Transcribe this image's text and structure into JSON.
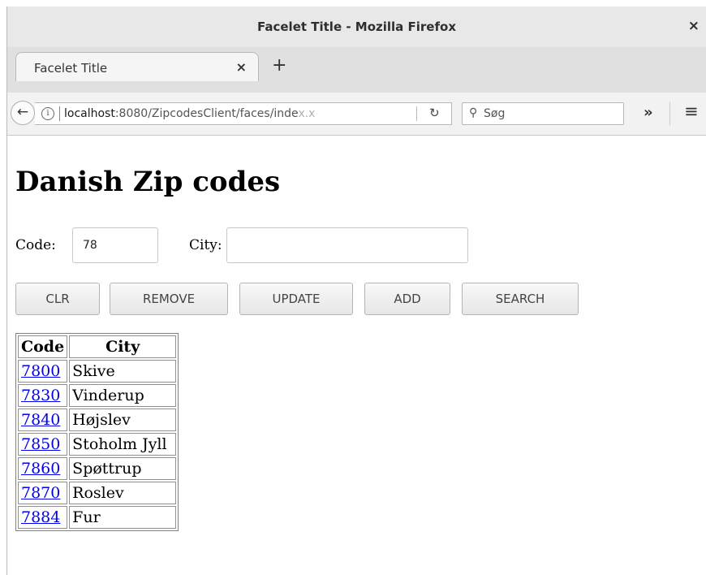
{
  "window": {
    "title": "Facelet Title - Mozilla Firefox",
    "close_glyph": "×"
  },
  "tabs": [
    {
      "label": "Facelet Title",
      "close_glyph": "×"
    }
  ],
  "new_tab_glyph": "+",
  "navbar": {
    "back_glyph": "←",
    "info_glyph": "i",
    "url_host": "localhost",
    "url_path": ":8080/ZipcodesClient/faces/inde",
    "url_fade": "x.x",
    "reload_glyph": "↻",
    "search_glyph": "⚲",
    "search_placeholder": "Søg",
    "overflow_glyph": "»",
    "menu_glyph": "≡"
  },
  "page": {
    "heading": "Danish Zip codes",
    "code_label": "Code:",
    "code_value": "78",
    "city_label": "City:",
    "city_value": "",
    "buttons": {
      "clr": "CLR",
      "remove": "REMOVE",
      "update": "UPDATE",
      "add": "ADD",
      "search": "SEARCH"
    },
    "table": {
      "headers": [
        "Code",
        "City"
      ],
      "rows": [
        {
          "code": "7800",
          "city": "Skive"
        },
        {
          "code": "7830",
          "city": "Vinderup"
        },
        {
          "code": "7840",
          "city": "Højslev"
        },
        {
          "code": "7850",
          "city": "Stoholm Jyll"
        },
        {
          "code": "7860",
          "city": "Spøttrup"
        },
        {
          "code": "7870",
          "city": "Roslev"
        },
        {
          "code": "7884",
          "city": "Fur"
        }
      ]
    }
  }
}
